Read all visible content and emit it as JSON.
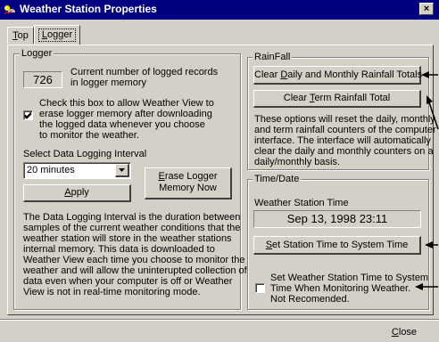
{
  "window": {
    "title": "Weather Station Properties",
    "close_glyph": "×"
  },
  "tabs": {
    "top_first": "T",
    "top_rest": "op",
    "logger_first": "L",
    "logger_rest": "ogger"
  },
  "logger": {
    "group_label": "Logger",
    "record_count": "726",
    "record_desc_1": "Current number of logged records",
    "record_desc_2": "in logger memory",
    "erase_check_1": "Check this box to allow Weather View to",
    "erase_check_2": "erase logger memory after downloading",
    "erase_check_3": "the logged data whenever you choose",
    "erase_check_4": "to monitor the weather.",
    "erase_checked": true,
    "interval_label": "Select Data Logging Interval",
    "interval_value": "20 minutes",
    "apply_first": "A",
    "apply_rest": "pply",
    "erase_btn_first": "E",
    "erase_btn_line1_rest": "rase Logger",
    "erase_btn_line2": "Memory Now",
    "description": [
      "The Data Logging Interval is the duration between",
      "samples of the current weather conditions that the",
      "weather station will store in the weather stations",
      "internal memory.  This data is downloaded to",
      "Weather View each time you choose to monitor the",
      "weather and will allow the uninterupted collection of",
      "data even when your computer is off or Weather",
      "View is not in real-time monitoring mode."
    ]
  },
  "rainfall": {
    "group_label": "RainFall",
    "clear_daily_pre": "Clear ",
    "clear_daily_key": "D",
    "clear_daily_post": "aily and Monthly Rainfall Totals",
    "clear_term_pre": "Clear ",
    "clear_term_key": "T",
    "clear_term_post": "erm Rainfall Total",
    "description": [
      "These options will reset the daily, monthly",
      "and term rainfall counters of the computer",
      "interface. The interface will automatically",
      "clear the daily and monthly counters on a",
      "daily/monthly basis."
    ]
  },
  "timedate": {
    "group_label": "Time/Date",
    "station_time_label": "Weather Station Time",
    "station_time_value": "Sep 13, 1998  23:11",
    "set_time_key": "S",
    "set_time_rest": "et Station Time to System Time",
    "auto_set_1": "Set Weather Station Time to System",
    "auto_set_2": "Time When Monitoring Weather.",
    "auto_set_3": "Not Recomended.",
    "auto_set_checked": false
  },
  "footer": {
    "close_key": "C",
    "close_rest": "lose"
  }
}
